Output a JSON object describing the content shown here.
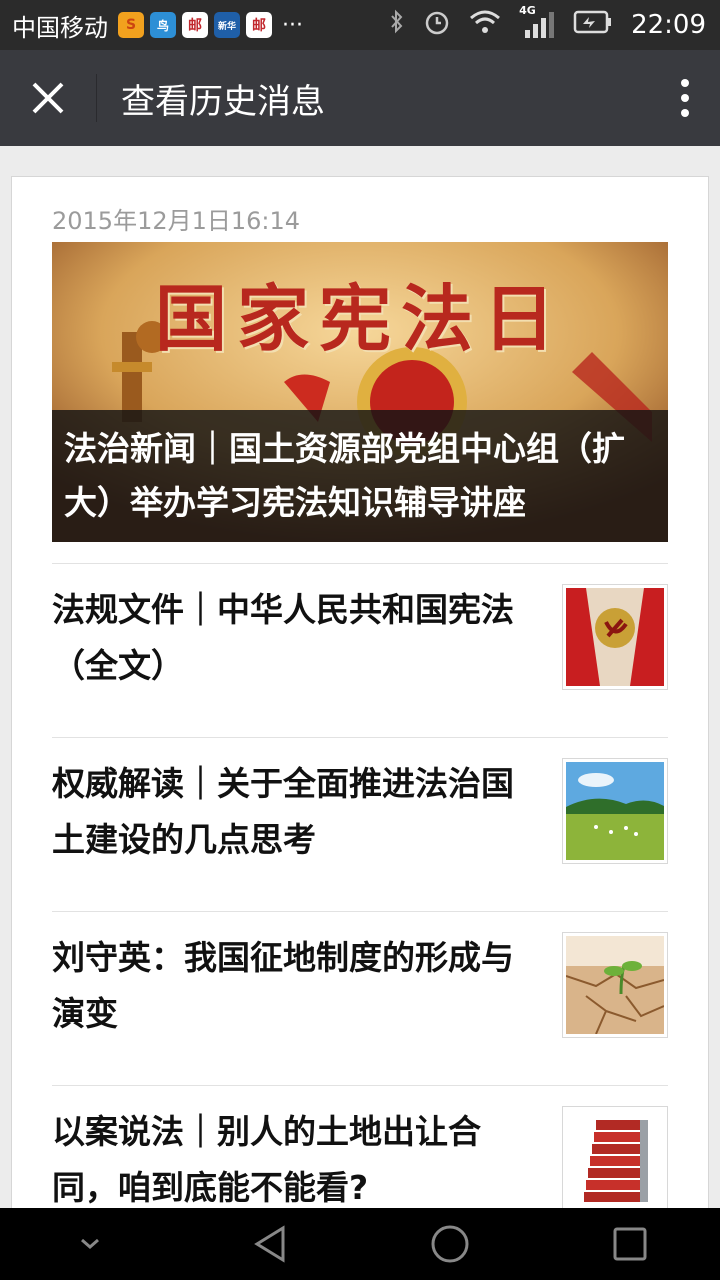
{
  "status_bar": {
    "carrier": "中国移动",
    "app_icons": [
      "S",
      "鸟",
      "邮",
      "新华",
      "邮"
    ],
    "more": "···",
    "network": "4G",
    "time": "22:09"
  },
  "titlebar": {
    "title": "查看历史消息"
  },
  "feed": {
    "date": "2015年12月1日16:14",
    "hero": {
      "banner_text": "国家宪法日",
      "title": "法治新闻｜国土资源部党组中心组（扩大）举办学习宪法知识辅导讲座"
    },
    "items": [
      {
        "title": "法规文件｜中华人民共和国宪法（全文）",
        "thumb_icon": "party-flag-icon"
      },
      {
        "title": "权威解读｜关于全面推进法治国土建设的几点思考",
        "thumb_icon": "grassland-icon"
      },
      {
        "title": "刘守英：我国征地制度的形成与演变",
        "thumb_icon": "cracked-earth-sprout-icon"
      },
      {
        "title": "以案说法｜别人的土地出让合同，咱到底能不能看?",
        "thumb_icon": "binders-stack-icon"
      }
    ]
  },
  "colors": {
    "titlebar_bg": "#393a3f",
    "status_bg": "#2b2b2b",
    "date_text": "#9b9b9b",
    "banner_red": "#b8281e"
  }
}
